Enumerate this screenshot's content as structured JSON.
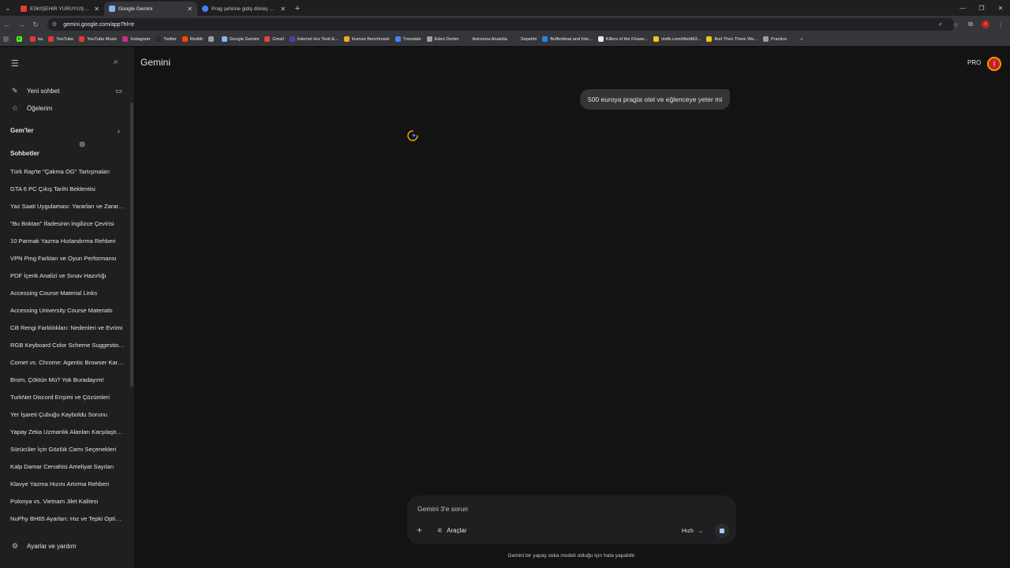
{
  "browser": {
    "tabs": [
      {
        "title": "ESKİŞEHİR YÜRÜYÜŞÜ DOKTOR",
        "favicon_color": "#e53935",
        "active": false
      },
      {
        "title": "Google Gemini",
        "favicon_color": "#8ab4f8",
        "active": true
      },
      {
        "title": "Prag şehrine gidiş dönüş | Goo",
        "favicon_color": "#4285f4",
        "active": false
      }
    ],
    "url": "gemini.google.com/app?hl=tr",
    "bookmarks": [
      {
        "label": "ba",
        "color": "#e53935"
      },
      {
        "label": "YouTube",
        "color": "#e53935"
      },
      {
        "label": "YouTube Music",
        "color": "#e53935"
      },
      {
        "label": "Instagram",
        "color": "#c13584"
      },
      {
        "label": "Twitter",
        "color": "#2b2b2b"
      },
      {
        "label": "Reddit",
        "color": "#ff4500"
      },
      {
        "label": "",
        "color": "#9aa0a6"
      },
      {
        "label": "Google Gemini",
        "color": "#8ab4f8"
      },
      {
        "label": "Gmail",
        "color": "#ea4335"
      },
      {
        "label": "İnternet Hız Testi &...",
        "color": "#5e35b1"
      },
      {
        "label": "Human Benchmark",
        "color": "#f9a825"
      },
      {
        "label": "Translate",
        "color": "#4285f4"
      },
      {
        "label": "Eden Denim",
        "color": "#9aa0a6"
      },
      {
        "label": "Avicenna Anatolia",
        "color": "#35363a"
      },
      {
        "label": "Sepetim",
        "color": "#35363a"
      },
      {
        "label": "Bufferbloat and Inte...",
        "color": "#1e88e5"
      },
      {
        "label": "Killers of the Flower...",
        "color": "#e8eaed"
      },
      {
        "label": "imdb.com/title/tt63...",
        "color": "#f5c518"
      },
      {
        "label": "And Then There We...",
        "color": "#f5c518"
      },
      {
        "label": "Practice",
        "color": "#9aa0a6"
      },
      {
        "label": "»",
        "color": "#35363a"
      }
    ]
  },
  "sidebar": {
    "new_chat": "Yeni sohbet",
    "my_stuff": "Öğelerim",
    "gems": "Gem'ler",
    "chats_heading": "Sohbetler",
    "chats": [
      "Türk Rap'te \"Çakma OG\" Tartışmaları",
      "GTA 6 PC Çıkış Tarihi Beklentisi",
      "Yaz Saati Uygulaması: Yararları ve Zararları",
      "\"Bu Boktan\" İfadesinin İngilizce Çevirisi",
      "10 Parmak Yazma Hızlandırma Rehberi",
      "VPN Ping Farkları ve Oyun Performansı",
      "PDF İçerik Analizi ve Sınav Hazırlığı",
      "Accessing Course Material Links",
      "Accessing University Course Materials",
      "Cilt Rengi Farklılıkları: Nedenleri ve Evrimi",
      "RGB Keyboard Color Scheme Suggestions",
      "Comet vs. Chrome: Agentic Browser Karşılaştırması",
      "Brom, Çöktün Mü? Yok Buradayım!",
      "TurkNet Discord Erişimi ve Çözümleri",
      "Yer İşareti Çubuğu Kayboldu Sorunu",
      "Yapay Zeka Uzmanlık Alanları Karşılaştırması",
      "Sürücüler İçin Gözlük Camı Seçenekleri",
      "Kalp Damar Cerrahisi Ameliyat Sayıları",
      "Klavye Yazma Hızını Artırma Rehberi",
      "Polonya vs. Vietnam Jilet Kalitesi",
      "NuPhy BH65 Ayarları: Hız ve Tepki Optimizasyonu"
    ],
    "settings": "Ayarlar ve yardım"
  },
  "header": {
    "title": "Gemini",
    "plan_badge": "PRO",
    "avatar_letter": "İ"
  },
  "conversation": {
    "user_message": "500 euroya pragta otel ve eğlenceye yeter mi"
  },
  "composer": {
    "placeholder": "Gemini 3'e sorun",
    "tools_label": "Araçlar",
    "mode_label": "Hızlı"
  },
  "disclaimer": "Gemini bir yapay zeka modeli olduğu için hata yapabilir."
}
